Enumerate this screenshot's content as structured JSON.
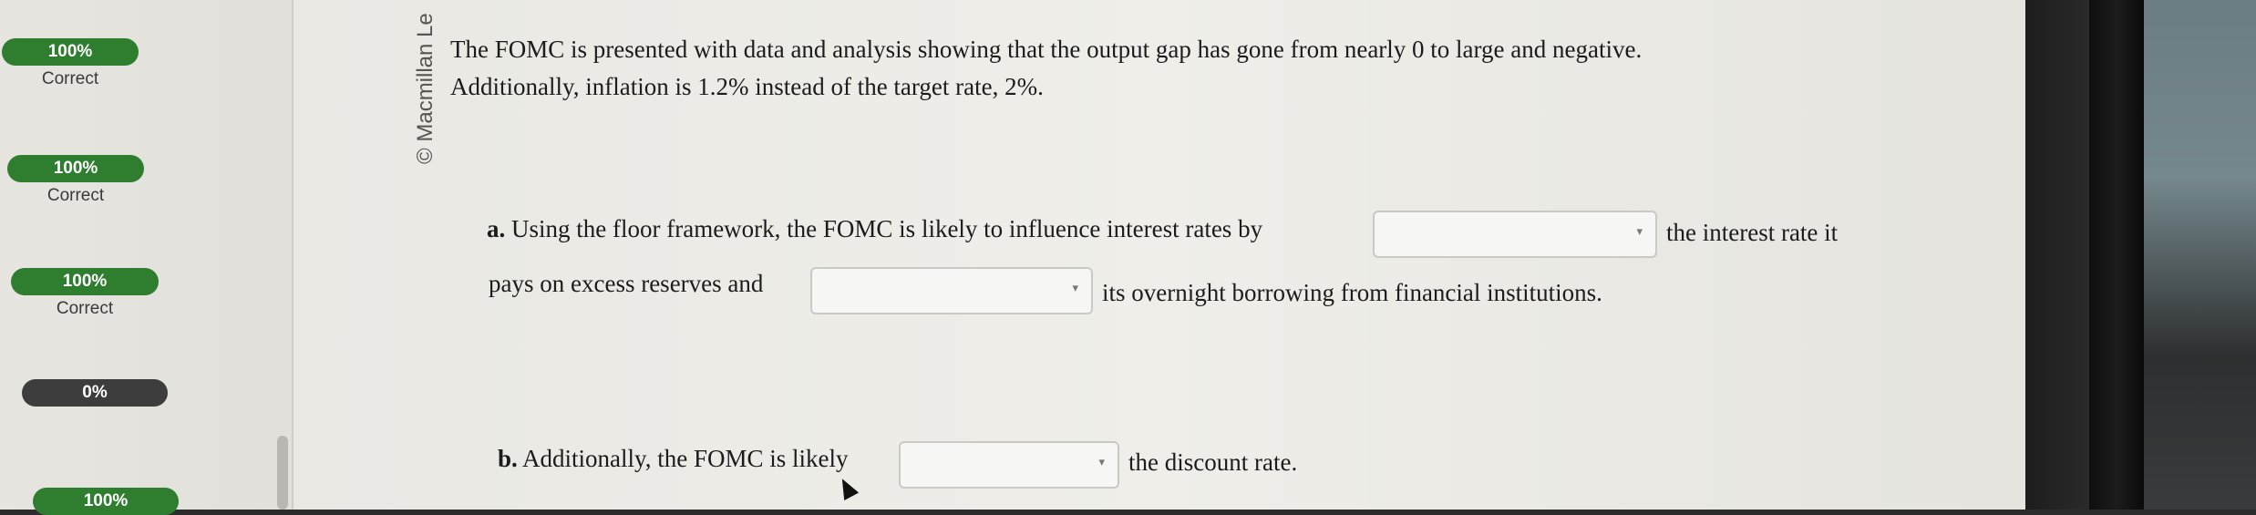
{
  "scores": [
    {
      "percent": "100%",
      "status": "Correct",
      "state": "correct"
    },
    {
      "percent": "100%",
      "status": "Correct",
      "state": "correct"
    },
    {
      "percent": "100%",
      "status": "Correct",
      "state": "correct"
    },
    {
      "percent": "0%",
      "status": "",
      "state": "incorrect"
    },
    {
      "percent": "100%",
      "status": "",
      "state": "correct"
    }
  ],
  "watermark": "© Macmillan Le",
  "question": {
    "intro_line1": "The FOMC is presented with data and analysis showing that the output gap has gone from nearly 0 to large and negative.",
    "intro_line2": "Additionally, inflation is 1.2% instead of the target rate, 2%.",
    "part_a": {
      "label": "a.",
      "text1": "Using the floor framework, the FOMC is likely to influence interest rates by",
      "text2": "the interest rate it",
      "text3": "pays on excess reserves and",
      "text4": "its overnight borrowing from financial institutions.",
      "dropdown1_value": "",
      "dropdown2_value": ""
    },
    "part_b": {
      "label": "b.",
      "text1": "Additionally, the FOMC is likely",
      "text2": "the discount rate.",
      "dropdown_value": ""
    }
  },
  "icons": {
    "dropdown_caret": "chevron-down-icon",
    "cursor": "mouse-pointer-icon"
  },
  "colors": {
    "correct": "#2f7d2f",
    "incorrect": "#3d3d3d",
    "page_bg": "#ecebe6",
    "text": "#1c1c1c"
  }
}
